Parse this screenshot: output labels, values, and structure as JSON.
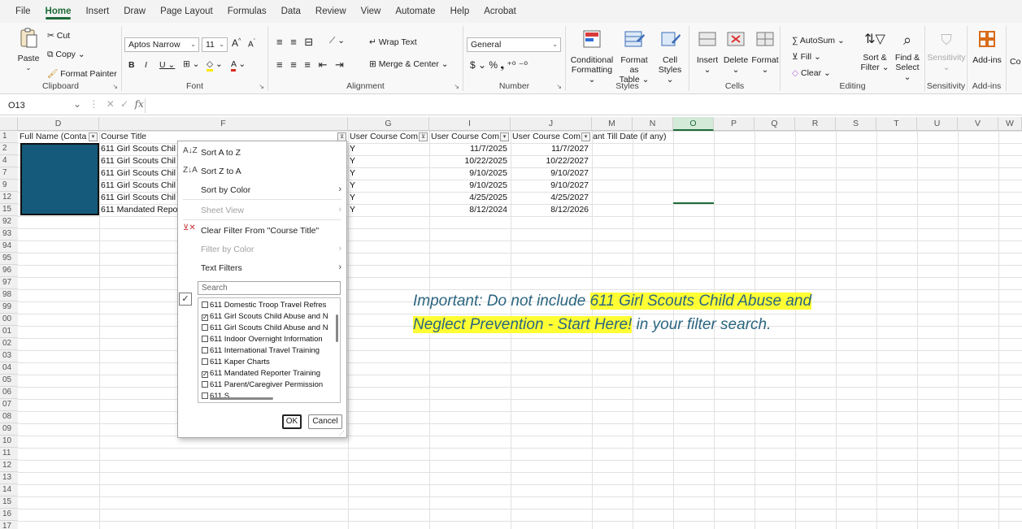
{
  "menu": {
    "tabs": [
      "File",
      "Home",
      "Insert",
      "Draw",
      "Page Layout",
      "Formulas",
      "Data",
      "Review",
      "View",
      "Automate",
      "Help",
      "Acrobat"
    ],
    "active": "Home"
  },
  "ribbon": {
    "clipboard": {
      "paste": "Paste",
      "cut": "Cut",
      "copy": "Copy",
      "format_painter": "Format Painter",
      "label": "Clipboard"
    },
    "font": {
      "name": "Aptos Narrow",
      "size": "11",
      "label": "Font"
    },
    "alignment": {
      "wrap": "Wrap Text",
      "merge": "Merge & Center",
      "label": "Alignment"
    },
    "number": {
      "format": "General",
      "label": "Number"
    },
    "styles": {
      "conditional": "Conditional",
      "conditional2": "Formatting",
      "format_table": "Format as",
      "format_table2": "Table",
      "cell_styles": "Cell",
      "cell_styles2": "Styles",
      "label": "Styles"
    },
    "cells": {
      "insert": "Insert",
      "delete": "Delete",
      "format": "Format",
      "label": "Cells"
    },
    "editing": {
      "autosum": "AutoSum",
      "fill": "Fill",
      "clear": "Clear",
      "sort": "Sort &",
      "sort2": "Filter",
      "find": "Find &",
      "find2": "Select",
      "label": "Editing"
    },
    "sensitivity": {
      "btn": "Sensitivity",
      "label": "Sensitivity"
    },
    "addins": {
      "btn": "Add-ins",
      "label": "Add-ins",
      "extra": "Co"
    }
  },
  "formula_bar": {
    "name_box": "O13",
    "fx": "fx"
  },
  "columns": [
    "D",
    "F",
    "G",
    "I",
    "J",
    "M",
    "N",
    "O",
    "P",
    "Q",
    "R",
    "S",
    "T",
    "U",
    "V",
    "W"
  ],
  "header_row": {
    "num": "1",
    "d": "Full Name (Conta",
    "f": "Course Title",
    "g": "User Course Com",
    "i": "User Course Com",
    "j": "User Course Com",
    "m": "ant Till Date (if any)"
  },
  "rows": [
    {
      "num": "2",
      "f": "611 Girl Scouts Chil",
      "g": "Y",
      "i": "11/7/2025",
      "j": "11/7/2027"
    },
    {
      "num": "4",
      "f": "611 Girl Scouts Chil",
      "g": "Y",
      "i": "10/22/2025",
      "j": "10/22/2027"
    },
    {
      "num": "7",
      "f": "611 Girl Scouts Chil",
      "g": "Y",
      "i": "9/10/2025",
      "j": "9/10/2027"
    },
    {
      "num": "9",
      "f": "611 Girl Scouts Chil",
      "g": "Y",
      "i": "9/10/2025",
      "j": "9/10/2027"
    },
    {
      "num": "12",
      "f": "611 Girl Scouts Chil",
      "g": "Y",
      "i": "4/25/2025",
      "j": "4/25/2027"
    },
    {
      "num": "15",
      "f": "611 Mandated Repo",
      "g": "Y",
      "i": "8/12/2024",
      "j": "8/12/2026"
    }
  ],
  "empty_rows": [
    "92",
    "93",
    "94",
    "95",
    "96",
    "97",
    "98",
    "99",
    "00",
    "01",
    "02",
    "03",
    "04",
    "05",
    "06",
    "07",
    "08",
    "09",
    "10",
    "11",
    "12",
    "13",
    "14",
    "15",
    "16",
    "17"
  ],
  "dropdown": {
    "sort_az": "Sort A to Z",
    "sort_za": "Sort Z to A",
    "sort_color": "Sort by Color",
    "sheet_view": "Sheet View",
    "clear_filter": "Clear Filter From \"Course Title\"",
    "filter_color": "Filter by Color",
    "text_filters": "Text Filters",
    "search_placeholder": "Search",
    "list": [
      {
        "label": "611 Domestic Troop Travel Refres",
        "checked": false
      },
      {
        "label": "611 Girl Scouts Child Abuse and N",
        "checked": true
      },
      {
        "label": "611 Girl Scouts Child Abuse and N",
        "checked": false
      },
      {
        "label": "611 Indoor Overnight Information",
        "checked": false
      },
      {
        "label": "611 International Travel Training",
        "checked": false
      },
      {
        "label": "611 Kaper Charts",
        "checked": false
      },
      {
        "label": "611 Mandated Reporter Training",
        "checked": true
      },
      {
        "label": "611 Parent/Caregiver Permission",
        "checked": false
      },
      {
        "label": "611 S...",
        "checked": false
      }
    ],
    "ok": "OK",
    "cancel": "Cancel"
  },
  "note": {
    "part1": "Important: Do not include ",
    "highlight": "611 Girl Scouts Child Abuse and Neglect Prevention - Start Here!",
    "part2": " in your filter search."
  }
}
